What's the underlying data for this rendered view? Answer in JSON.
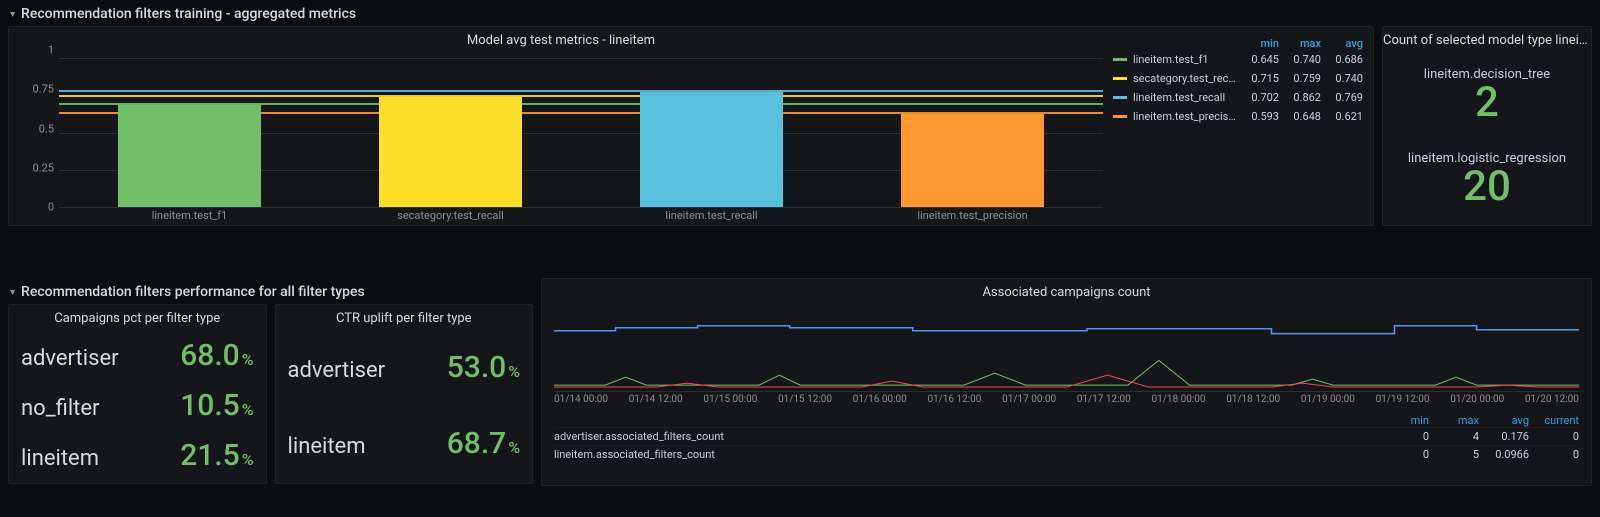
{
  "rows": {
    "r1_title": "Recommendation filters training - aggregated metrics",
    "r2_title": "Recommendation filters performance for all filter types"
  },
  "bar_panel": {
    "title": "Model avg test metrics - lineitem",
    "legend_head": {
      "min": "min",
      "max": "max",
      "avg": "avg"
    }
  },
  "count_panel": {
    "title": "Count of selected model type lineit…",
    "items": [
      {
        "label": "lineitem.decision_tree",
        "value": "2"
      },
      {
        "label": "lineitem.logistic_regression",
        "value": "20"
      }
    ]
  },
  "stat1": {
    "title": "Campaigns pct per filter type",
    "rows": [
      {
        "name": "advertiser",
        "value": "68.0"
      },
      {
        "name": "no_filter",
        "value": "10.5"
      },
      {
        "name": "lineitem",
        "value": "21.5"
      }
    ]
  },
  "stat2": {
    "title": "CTR uplift per filter type",
    "rows": [
      {
        "name": "advertiser",
        "value": "53.0"
      },
      {
        "name": "lineitem",
        "value": "68.7"
      }
    ]
  },
  "ts_panel": {
    "title": "Associated campaigns count",
    "x_ticks": [
      "01/14 00:00",
      "01/14 12:00",
      "01/15 00:00",
      "01/15 12:00",
      "01/16 00:00",
      "01/16 12:00",
      "01/17 00:00",
      "01/17 12:00",
      "01/18 00:00",
      "01/18 12:00",
      "01/19 00:00",
      "01/19 12:00",
      "01/20 00:00",
      "01/20 12:00"
    ],
    "head": {
      "min": "min",
      "max": "max",
      "avg": "avg",
      "current": "current"
    },
    "rows": [
      {
        "name": "advertiser.associated_filters_count",
        "min": "0",
        "max": "4",
        "avg": "0.176",
        "current": "0"
      },
      {
        "name": "lineitem.associated_filters_count",
        "min": "0",
        "max": "5",
        "avg": "0.0966",
        "current": "0"
      }
    ]
  },
  "chart_data": [
    {
      "type": "bar",
      "title": "Model avg test metrics - lineitem",
      "categories": [
        "lineitem.test_f1",
        "secategory.test_recall",
        "lineitem.test_recall",
        "lineitem.test_precision"
      ],
      "series": [
        {
          "name": "lineitem.test_f1",
          "min": 0.645,
          "max": 0.74,
          "avg": 0.686,
          "color": "#73bf69"
        },
        {
          "name": "secategory.test_recall",
          "min": 0.715,
          "max": 0.759,
          "avg": 0.74,
          "color": "#fade2a"
        },
        {
          "name": "lineitem.test_recall",
          "min": 0.702,
          "max": 0.862,
          "avg": 0.769,
          "color": "#5bc0de"
        },
        {
          "name": "lineitem.test_precision",
          "min": 0.593,
          "max": 0.648,
          "avg": 0.621,
          "color": "#ff9830"
        }
      ],
      "y_ticks": [
        0,
        0.25,
        0.5,
        0.75,
        1
      ],
      "ylim": [
        0,
        1
      ]
    },
    {
      "type": "table",
      "title": "Count of selected model type lineitem",
      "rows": [
        {
          "label": "lineitem.decision_tree",
          "value": 2
        },
        {
          "label": "lineitem.logistic_regression",
          "value": 20
        }
      ]
    },
    {
      "type": "table",
      "title": "Campaigns pct per filter type",
      "rows": [
        {
          "label": "advertiser",
          "value": 68.0
        },
        {
          "label": "no_filter",
          "value": 10.5
        },
        {
          "label": "lineitem",
          "value": 21.5
        }
      ],
      "unit": "%"
    },
    {
      "type": "table",
      "title": "CTR uplift per filter type",
      "rows": [
        {
          "label": "advertiser",
          "value": 53.0
        },
        {
          "label": "lineitem",
          "value": 68.7
        }
      ],
      "unit": "%"
    },
    {
      "type": "line",
      "title": "Associated campaigns count",
      "x_ticks": [
        "01/14 00:00",
        "01/14 12:00",
        "01/15 00:00",
        "01/15 12:00",
        "01/16 00:00",
        "01/16 12:00",
        "01/17 00:00",
        "01/17 12:00",
        "01/18 00:00",
        "01/18 12:00",
        "01/19 00:00",
        "01/19 12:00",
        "01/20 00:00",
        "01/20 12:00"
      ],
      "ylim": [
        0,
        5
      ],
      "series": [
        {
          "name": "advertiser.associated_filters_count",
          "min": 0,
          "max": 4,
          "avg": 0.176,
          "current": 0,
          "color": "#5794f2"
        },
        {
          "name": "lineitem.associated_filters_count",
          "min": 0,
          "max": 5,
          "avg": 0.0966,
          "current": 0,
          "color": "#73bf69"
        }
      ]
    }
  ]
}
